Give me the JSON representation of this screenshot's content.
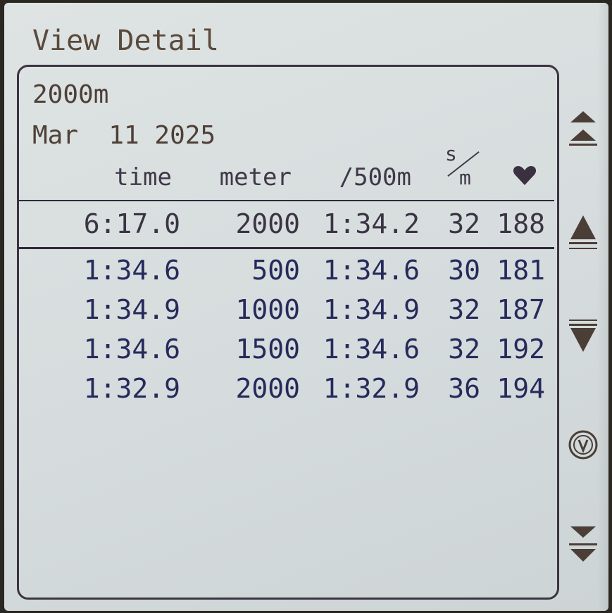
{
  "window": {
    "title": "View Detail"
  },
  "workout": {
    "distance": "2000m",
    "date": "Mar  11 2025"
  },
  "table": {
    "headers": {
      "time": "time",
      "meter": "meter",
      "split": "/500m",
      "spm_top": "s",
      "spm_bottom": "m"
    },
    "heart_icon": "heart-icon",
    "summary": {
      "time": "6:17.0",
      "meter": "2000",
      "split": "1:34.2",
      "spm": "32",
      "hr": "188"
    },
    "rows": [
      {
        "time": "1:34.6",
        "meter": "500",
        "split": "1:34.6",
        "spm": "30",
        "hr": "181"
      },
      {
        "time": "1:34.9",
        "meter": "1000",
        "split": "1:34.9",
        "spm": "32",
        "hr": "187"
      },
      {
        "time": "1:34.6",
        "meter": "1500",
        "split": "1:34.6",
        "spm": "32",
        "hr": "192"
      },
      {
        "time": "1:32.9",
        "meter": "2000",
        "split": "1:32.9",
        "spm": "36",
        "hr": "194"
      }
    ]
  },
  "side_buttons": [
    {
      "icon": "page-up-double-arrow-icon"
    },
    {
      "icon": "scroll-up-arrow-icon"
    },
    {
      "icon": "scroll-down-arrow-icon"
    },
    {
      "icon": "menu-back-circle-icon"
    },
    {
      "icon": "page-down-double-arrow-icon"
    }
  ],
  "colors": {
    "screen_bg": "#d9dfe0",
    "text_dark": "#2c2a3e",
    "text_brown": "#4e4038",
    "split_text": "#262a5a"
  }
}
